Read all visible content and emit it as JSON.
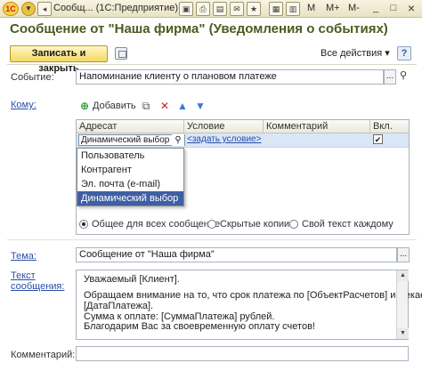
{
  "window": {
    "title": "Сообщ... (1С:Предприятие)",
    "logo": "1С",
    "titlebar_icons": [
      "nav-arrow-icon",
      "save-icon",
      "print-icon",
      "preview-icon",
      "mail-icon",
      "calendar-icon",
      "calc-icon"
    ],
    "m_button": "M",
    "m_plus": "M+",
    "m_minus": "M-",
    "minimize": "_",
    "maximize": "□",
    "close": "×"
  },
  "header": {
    "title": "Сообщение от \"Наша фирма\" (Уведомления о событиях)"
  },
  "toolbar": {
    "save_close_label": "Записать и закрыть",
    "all_actions_label": "Все действия ▾",
    "help_label": "?"
  },
  "form": {
    "event_label": "Событие:",
    "event_value": "Напоминание клиенту о плановом платеже",
    "to_label": "Кому:",
    "add_label": "Добавить",
    "columns": [
      "Адресат",
      "Условие",
      "Комментарий",
      "Вкл."
    ],
    "row": {
      "addressee": "Динамический выбор",
      "condition": "<задать условие>",
      "comment": "",
      "enabled": true
    },
    "dropdown_options": [
      "Пользователь",
      "Контрагент",
      "Эл. почта (e-mail)",
      "Динамический выбор"
    ],
    "dropdown_selected": "Динамический выбор",
    "radios": [
      "Общее для всех сообщение",
      "Скрытые копии",
      "Свой текст каждому"
    ],
    "radio_selected": "Общее для всех сообщение",
    "subject_label": "Тема:",
    "subject_value": "Сообщение от \"Наша фирма\"",
    "message_label_1": "Текст",
    "message_label_2": "сообщения:",
    "message_lines": [
      "Уважаемый [Клиент].",
      "",
      "Обращаем внимание на то, что срок платежа по [ОбъектРасчетов] истекает",
      "[ДатаПлатежа].",
      "Сумма к оплате: [СуммаПлатежа] рублей.",
      "Благодарим Вас за своевременную оплату счетов!"
    ],
    "comment_label": "Комментарий:",
    "comment_value": ""
  },
  "colors": {
    "accent_title": "#4e5a1f",
    "link": "#2c4ea8",
    "selection": "#3f5fa3",
    "button_yellow": "#f3d960"
  }
}
